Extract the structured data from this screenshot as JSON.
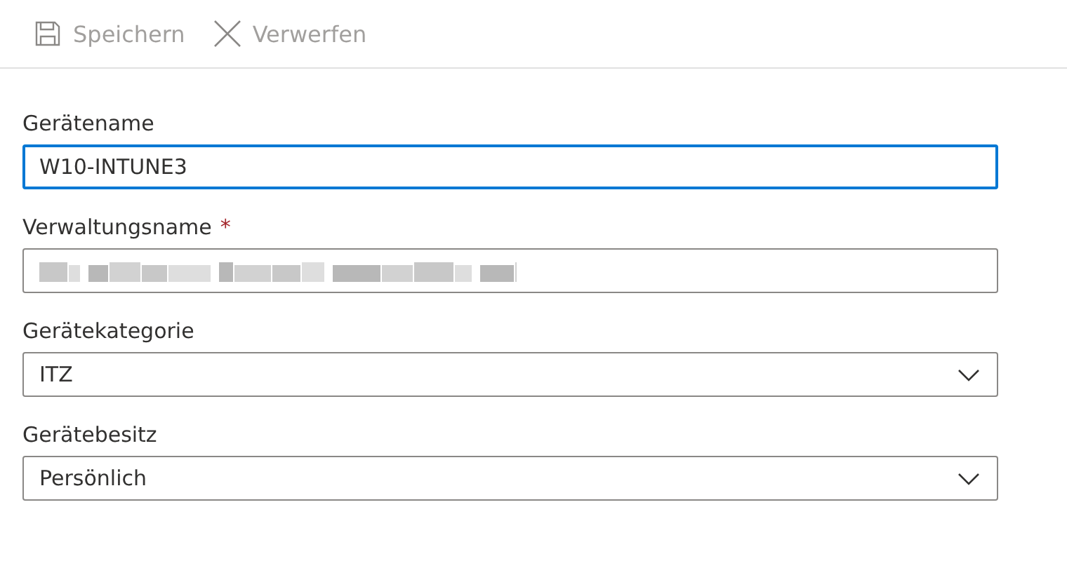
{
  "toolbar": [
    {
      "kind": "save",
      "label": "Speichern",
      "disabled": true
    },
    {
      "kind": "discard",
      "label": "Verwerfen",
      "disabled": true
    }
  ],
  "fields": [
    {
      "kind": "text",
      "label": "Gerätename",
      "value": "W10-INTUNE3",
      "focused": true
    },
    {
      "kind": "redacted",
      "label": "Verwaltungsname",
      "required_mark": "*",
      "focused": false
    },
    {
      "kind": "select",
      "label": "Gerätekategorie",
      "value": "ITZ",
      "focused": false
    },
    {
      "kind": "select",
      "label": "Gerätebesitz",
      "value": "Persönlich",
      "focused": false
    }
  ]
}
